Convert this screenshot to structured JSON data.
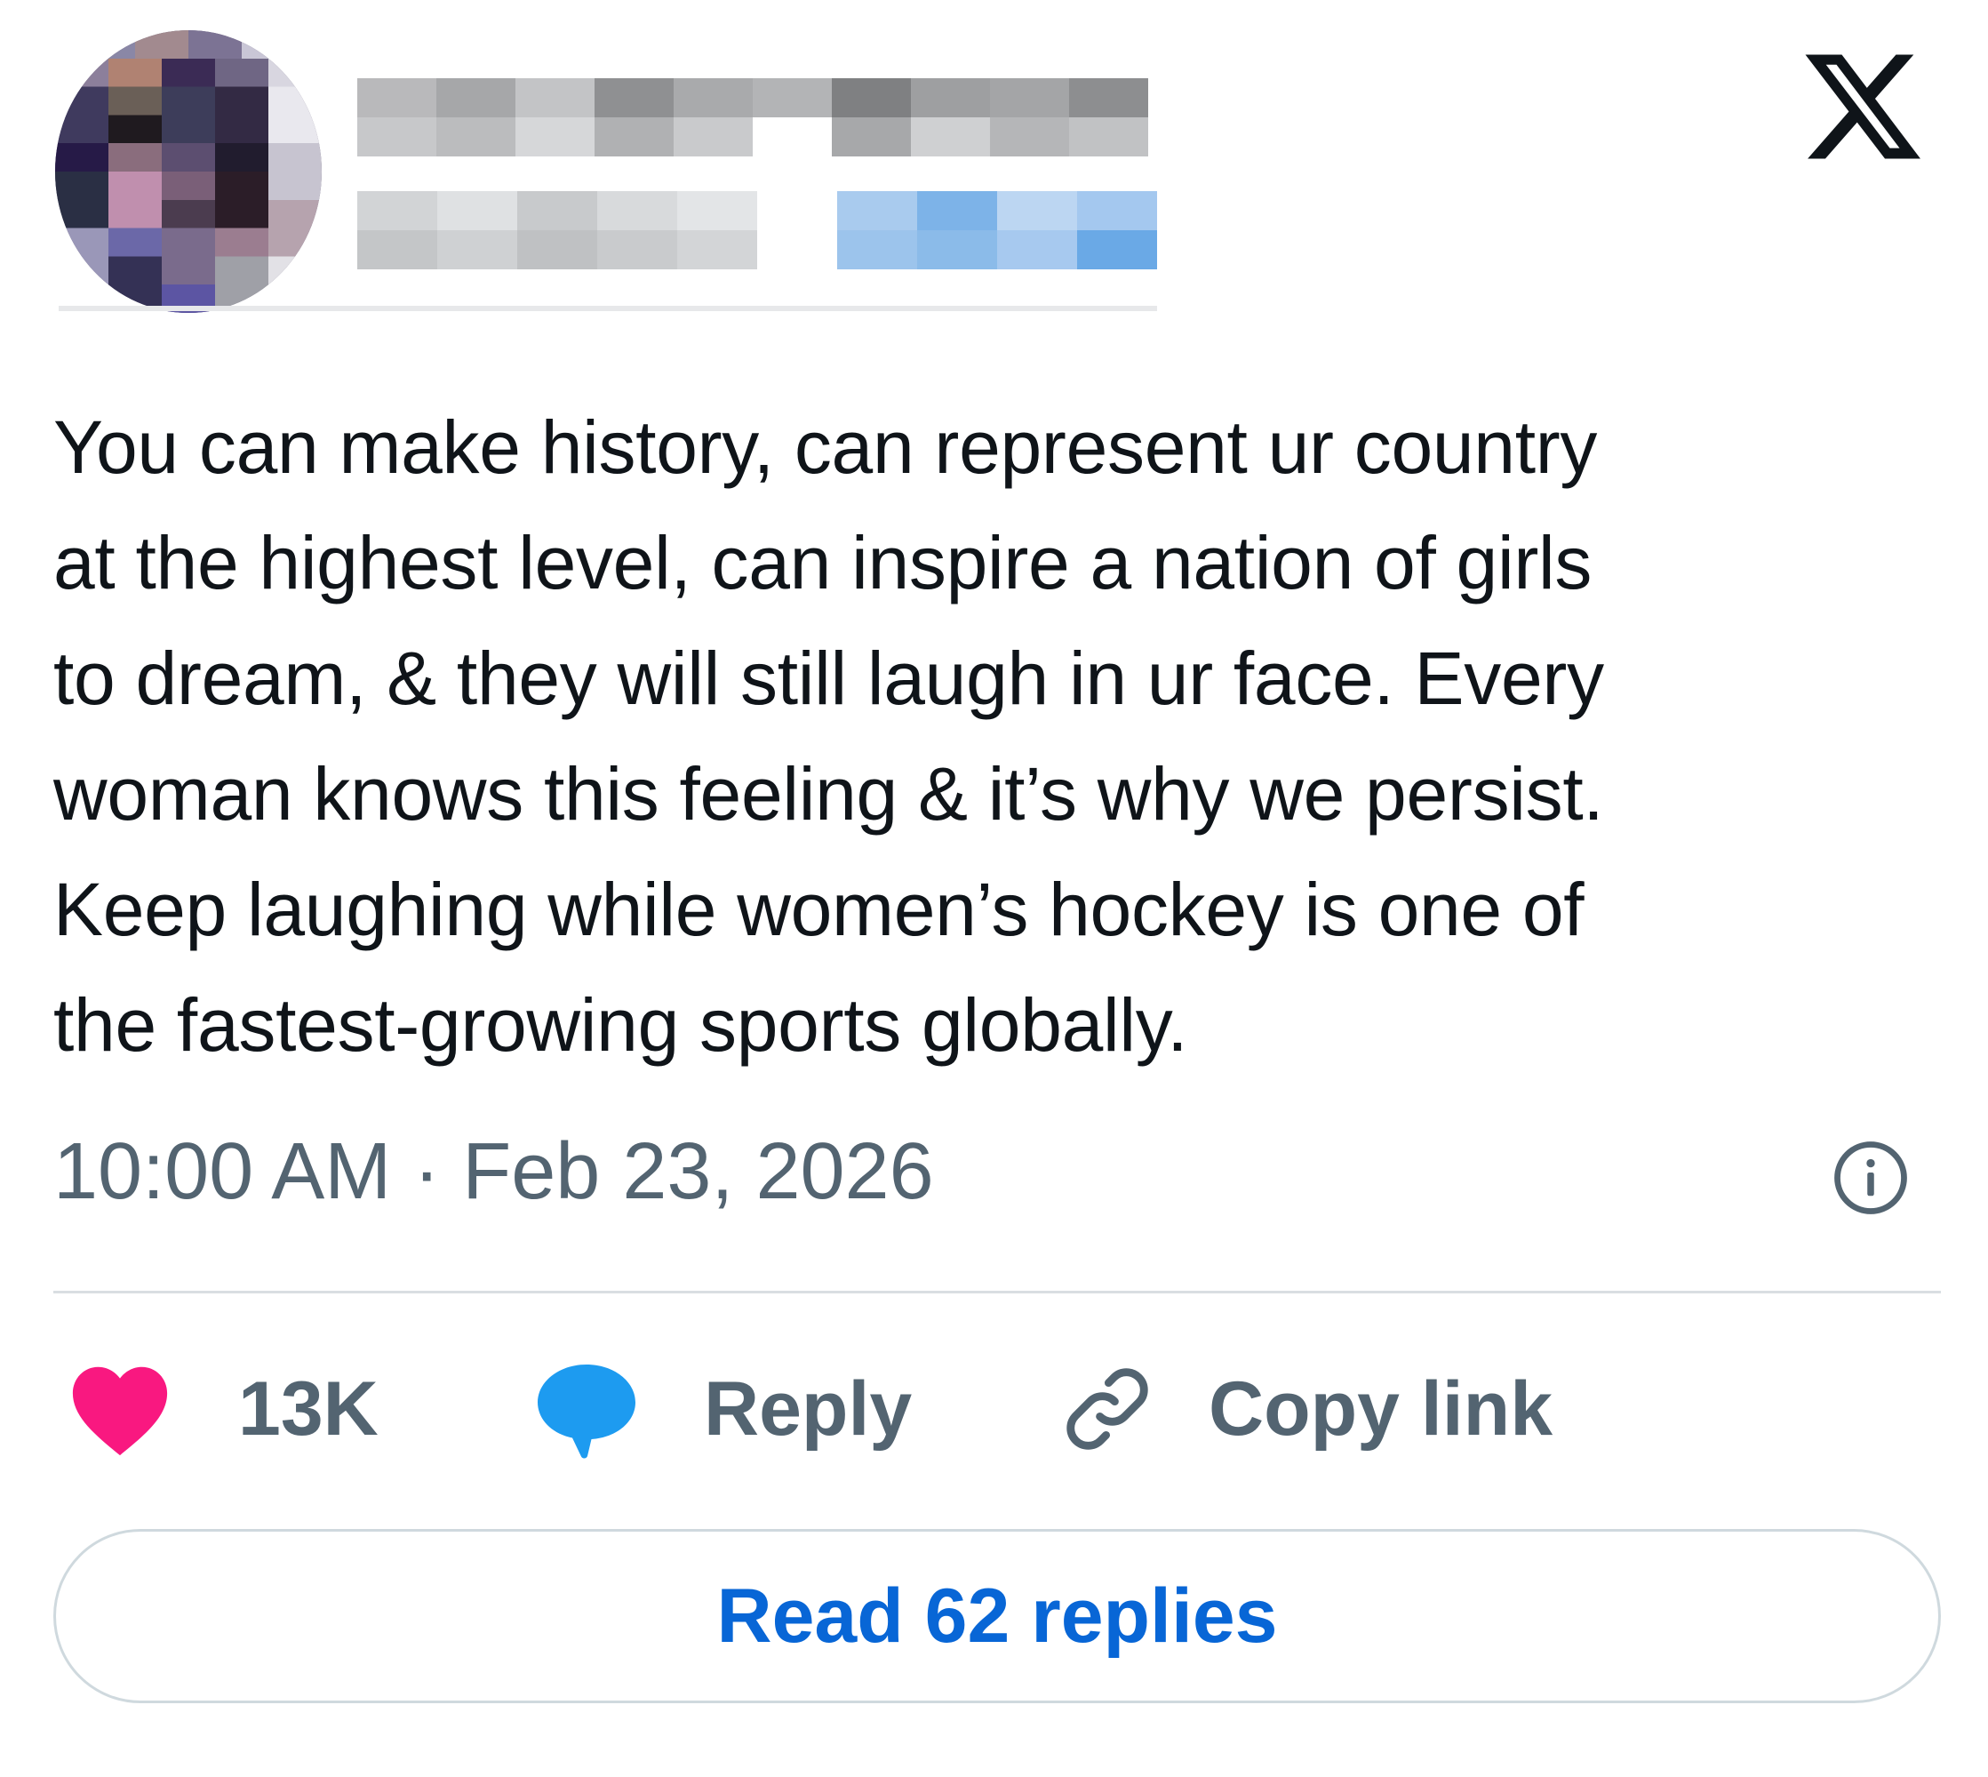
{
  "post": {
    "text": "You can make history, can represent ur country\nat the highest level, can inspire a nation of girls\nto dream, & they will still laugh in ur face. Every\nwoman knows this feeling & it’s why we persist.\nKeep laughing while women’s hockey is one of\nthe fastest-growing sports globally.",
    "timestamp": "10:00 AM · Feb 23, 2026"
  },
  "actions": {
    "like_count": "13K",
    "reply_label": "Reply",
    "copy_link_label": "Copy link"
  },
  "footer": {
    "read_replies_label": "Read 62 replies"
  },
  "icons": {
    "logo": "x-logo-icon",
    "info": "info-icon",
    "like": "heart-icon",
    "reply": "speech-bubble-icon",
    "copy": "link-icon"
  },
  "colors": {
    "text": "#0f1419",
    "secondary_text": "#536471",
    "like": "#f91880",
    "reply": "#1d9bf0",
    "link_blue": "#0866d6",
    "border": "#cfd9de"
  }
}
